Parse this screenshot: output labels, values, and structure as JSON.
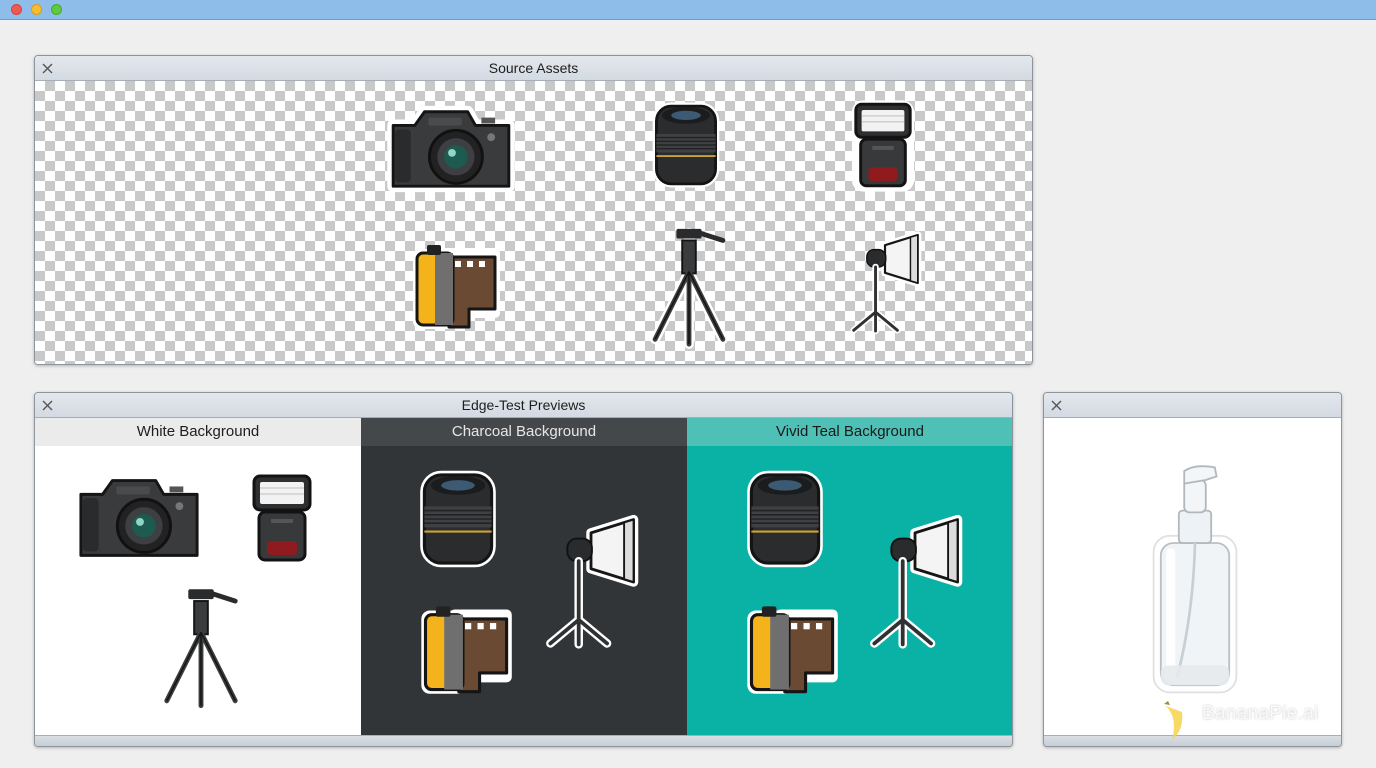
{
  "window": {
    "controls": [
      "close",
      "minimize",
      "zoom"
    ]
  },
  "source_panel": {
    "title": "Source Assets",
    "assets": [
      {
        "icon": "camera-icon"
      },
      {
        "icon": "lens-icon"
      },
      {
        "icon": "flash-icon"
      },
      {
        "icon": "film-roll-icon"
      },
      {
        "icon": "tripod-icon"
      },
      {
        "icon": "softbox-light-icon"
      }
    ]
  },
  "edge_panel": {
    "title": "Edge-Test Previews",
    "columns": [
      {
        "label": "White Background",
        "bg_color": "#ffffff",
        "assets": [
          "camera-icon",
          "flash-icon",
          "tripod-icon"
        ]
      },
      {
        "label": "Charcoal Background",
        "bg_color": "#323537",
        "assets": [
          "lens-icon",
          "softbox-light-icon",
          "film-roll-icon"
        ]
      },
      {
        "label": "Vivid Teal Background",
        "bg_color": "#0ab2a6",
        "assets": [
          "lens-icon",
          "softbox-light-icon",
          "film-roll-icon"
        ]
      }
    ]
  },
  "single_panel": {
    "asset": "pump-bottle-icon"
  },
  "watermark": {
    "text": "BananaPie.ai"
  }
}
